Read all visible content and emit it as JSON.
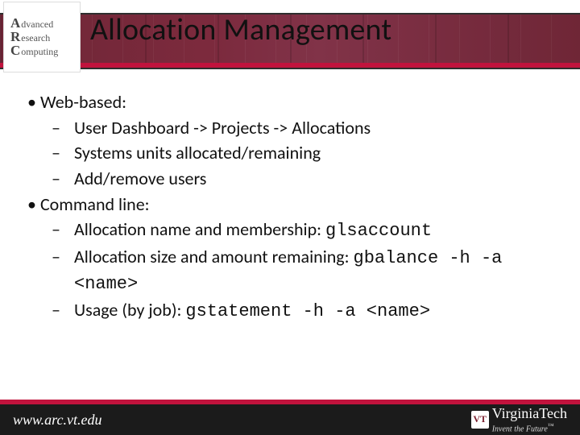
{
  "title": "Allocation Management",
  "logo": {
    "line1": "dvanced",
    "line2": "esearch",
    "line3": "omputing"
  },
  "body": {
    "web": {
      "heading": "Web-based:",
      "items": [
        "User Dashboard -> Projects -> Allocations",
        "Systems units allocated/remaining",
        "Add/remove users"
      ]
    },
    "cli": {
      "heading": "Command line:",
      "items": [
        {
          "text": "Allocation name and membership:",
          "cmd": "glsaccount"
        },
        {
          "text": "Allocation size and amount remaining:",
          "cmd": "gbalance -h -a <name>"
        },
        {
          "text": "Usage (by job):",
          "cmd": "gstatement -h -a <name>"
        }
      ]
    }
  },
  "footer": {
    "url": "www.arc.vt.edu",
    "brand": "VirginiaTech",
    "tagline": "Invent the Future"
  }
}
